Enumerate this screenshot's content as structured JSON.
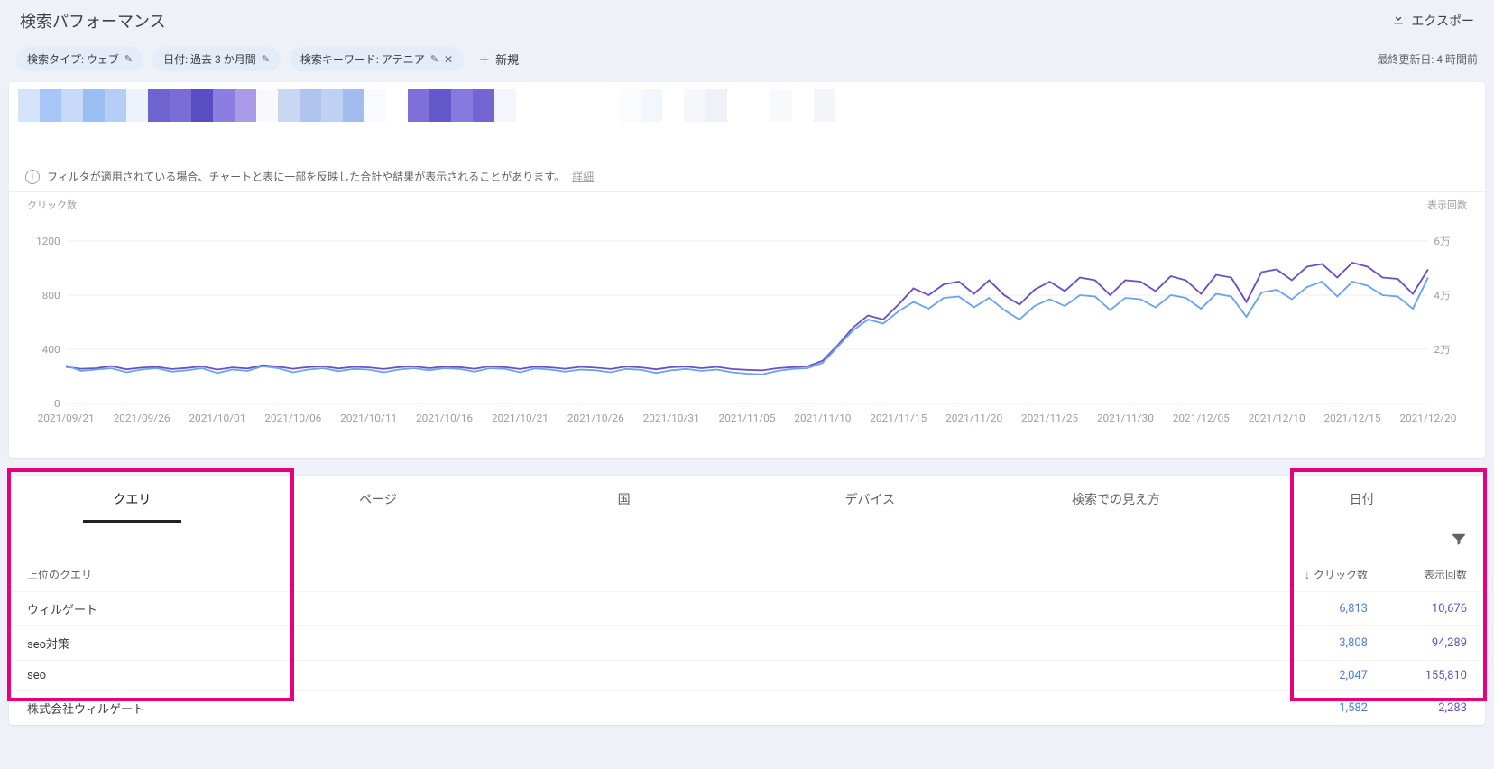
{
  "header": {
    "title": "検索パフォーマンス",
    "export": "エクスポー"
  },
  "filters": {
    "chips": [
      {
        "label": "検索タイプ: ウェブ",
        "editable": true,
        "removable": false
      },
      {
        "label": "日付: 過去 3 か月間",
        "editable": true,
        "removable": false
      },
      {
        "label": "検索キーワード: アテニア",
        "editable": true,
        "removable": true
      }
    ],
    "add_new": "新規",
    "last_updated": "最終更新日: 4 時間前"
  },
  "info": {
    "text": "フィルタが適用されている場合、チャートと表に一部を反映した合計や結果が表示されることがあります。",
    "more": "詳細"
  },
  "chart_axis": {
    "left_label": "クリック数",
    "right_label": "表示回数",
    "right_max_tick": "6万",
    "right_mid1_tick": "4万",
    "right_mid2_tick": "2万"
  },
  "chart_data": {
    "type": "line",
    "xlabel": "",
    "ylabel_left": "クリック数",
    "ylabel_right": "表示回数",
    "ylim_left": [
      0,
      1200
    ],
    "ylim_right": [
      0,
      60000
    ],
    "x_ticks": [
      "2021/09/21",
      "2021/09/26",
      "2021/10/01",
      "2021/10/06",
      "2021/10/11",
      "2021/10/16",
      "2021/10/21",
      "2021/10/26",
      "2021/10/31",
      "2021/11/05",
      "2021/11/10",
      "2021/11/15",
      "2021/11/20",
      "2021/11/25",
      "2021/11/30",
      "2021/12/05",
      "2021/12/10",
      "2021/12/15",
      "2021/12/20"
    ],
    "y_ticks_left": [
      0,
      400,
      800,
      1200
    ],
    "series": [
      {
        "name": "クリック数",
        "axis": "left",
        "color": "#6aa4ee",
        "values": [
          280,
          240,
          250,
          260,
          230,
          250,
          260,
          235,
          245,
          260,
          225,
          250,
          240,
          275,
          260,
          230,
          250,
          260,
          238,
          255,
          250,
          230,
          250,
          260,
          245,
          260,
          255,
          235,
          260,
          255,
          230,
          258,
          250,
          235,
          250,
          245,
          230,
          255,
          248,
          225,
          245,
          255,
          240,
          250,
          230,
          220,
          215,
          240,
          255,
          260,
          300,
          420,
          540,
          620,
          590,
          680,
          750,
          700,
          780,
          790,
          710,
          780,
          690,
          620,
          720,
          770,
          720,
          800,
          790,
          690,
          780,
          770,
          710,
          800,
          780,
          700,
          810,
          790,
          640,
          820,
          840,
          770,
          860,
          900,
          790,
          900,
          870,
          800,
          790,
          700,
          930
        ]
      },
      {
        "name": "表示回数",
        "axis": "right",
        "color": "#6c4fc7",
        "values": [
          13500,
          12800,
          13000,
          13800,
          12600,
          13200,
          13500,
          12700,
          13100,
          13700,
          12500,
          13300,
          12900,
          14100,
          13600,
          12800,
          13400,
          13700,
          12900,
          13500,
          13300,
          12700,
          13400,
          13700,
          13000,
          13600,
          13400,
          12800,
          13700,
          13400,
          12700,
          13600,
          13300,
          12800,
          13500,
          13200,
          12700,
          13600,
          13300,
          12600,
          13400,
          13600,
          13000,
          13500,
          12700,
          12400,
          12200,
          13000,
          13400,
          13700,
          15800,
          21500,
          28000,
          32500,
          31000,
          36500,
          42500,
          40000,
          44000,
          45000,
          40500,
          45500,
          40000,
          36500,
          42000,
          45000,
          41500,
          46500,
          45500,
          40000,
          45500,
          45000,
          41500,
          47000,
          45500,
          40500,
          47500,
          46500,
          37500,
          48500,
          49500,
          45500,
          50500,
          51500,
          46500,
          52000,
          50500,
          46500,
          46000,
          40500,
          49500
        ]
      }
    ]
  },
  "tabs": [
    "クエリ",
    "ページ",
    "国",
    "デバイス",
    "検索での見え方",
    "日付"
  ],
  "active_tab": 0,
  "table": {
    "header_query": "上位のクエリ",
    "header_clicks": "クリック数",
    "header_impressions": "表示回数",
    "rows": [
      {
        "query": "ウィルゲート",
        "clicks": "6,813",
        "impressions": "10,676"
      },
      {
        "query": "seo対策",
        "clicks": "3,808",
        "impressions": "94,289"
      },
      {
        "query": "seo",
        "clicks": "2,047",
        "impressions": "155,810"
      },
      {
        "query": "株式会社ウィルゲート",
        "clicks": "1,582",
        "impressions": "2,283"
      }
    ]
  }
}
